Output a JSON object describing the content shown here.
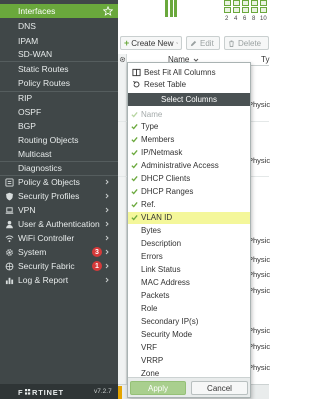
{
  "sidebar": {
    "items": [
      {
        "label": "Interfaces",
        "active": true
      },
      {
        "label": "DNS"
      },
      {
        "label": "IPAM"
      },
      {
        "label": "SD-WAN"
      },
      {
        "label": "Static Routes"
      },
      {
        "label": "Policy Routes"
      },
      {
        "label": "RIP"
      },
      {
        "label": "OSPF"
      },
      {
        "label": "BGP"
      },
      {
        "label": "Routing Objects"
      },
      {
        "label": "Multicast"
      },
      {
        "label": "Diagnostics"
      }
    ],
    "sections": [
      {
        "label": "Policy & Objects",
        "icon": "policy-icon"
      },
      {
        "label": "Security Profiles",
        "icon": "shield-icon"
      },
      {
        "label": "VPN",
        "icon": "laptop-icon"
      },
      {
        "label": "User & Authentication",
        "icon": "user-icon"
      },
      {
        "label": "WiFi Controller",
        "icon": "wifi-icon"
      },
      {
        "label": "System",
        "icon": "gear-icon",
        "badge": "3"
      },
      {
        "label": "Security Fabric",
        "icon": "fabric-icon",
        "badge": "1"
      },
      {
        "label": "Log & Report",
        "icon": "chart-icon"
      }
    ],
    "brand": "F⛿RTINET",
    "version": "v7.2.7"
  },
  "ports": [
    "2",
    "4",
    "6",
    "8",
    "10"
  ],
  "toolbar": {
    "create_new": "Create New",
    "edit": "Edit",
    "delete": "Delete"
  },
  "table": {
    "col_name": "Name",
    "col_type_partial": "Ty",
    "cell_type": "Physic"
  },
  "dropdown": {
    "best_fit": "Best Fit All Columns",
    "reset_table": "Reset Table",
    "select_columns_header": "Select Columns",
    "columns": [
      {
        "label": "Name",
        "checked": true,
        "disabled": true
      },
      {
        "label": "Type",
        "checked": true
      },
      {
        "label": "Members",
        "checked": true
      },
      {
        "label": "IP/Netmask",
        "checked": true
      },
      {
        "label": "Administrative Access",
        "checked": true
      },
      {
        "label": "DHCP Clients",
        "checked": true
      },
      {
        "label": "DHCP Ranges",
        "checked": true
      },
      {
        "label": "Ref.",
        "checked": true
      },
      {
        "label": "VLAN ID",
        "checked": true,
        "highlighted": true
      },
      {
        "label": "Bytes",
        "checked": false
      },
      {
        "label": "Description",
        "checked": false
      },
      {
        "label": "Errors",
        "checked": false
      },
      {
        "label": "Link Status",
        "checked": false
      },
      {
        "label": "MAC Address",
        "checked": false
      },
      {
        "label": "Packets",
        "checked": false
      },
      {
        "label": "Role",
        "checked": false
      },
      {
        "label": "Secondary IP(s)",
        "checked": false
      },
      {
        "label": "Security Mode",
        "checked": false
      },
      {
        "label": "VRF",
        "checked": false
      },
      {
        "label": "VRRP",
        "checked": false
      },
      {
        "label": "Zone",
        "checked": false
      }
    ],
    "apply": "Apply",
    "cancel": "Cancel"
  },
  "colors": {
    "accent_green": "#6aa83c",
    "sidebar_bg": "#404748",
    "badge_red": "#d63a3a",
    "highlight_yellow": "#f4f79a"
  }
}
